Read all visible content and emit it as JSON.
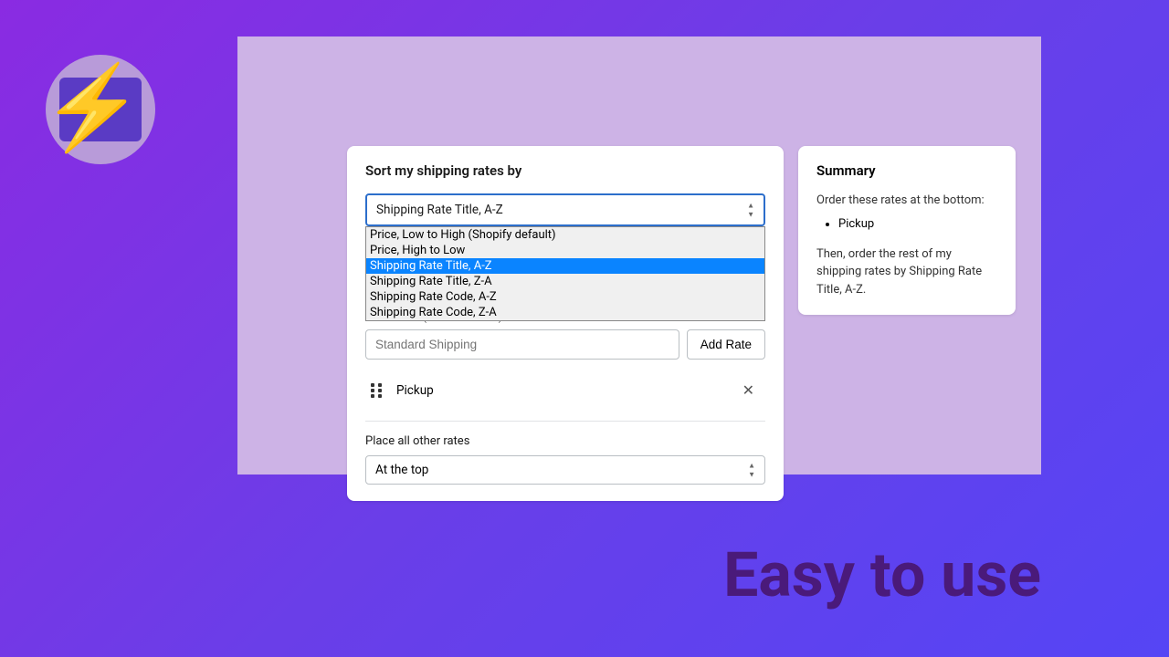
{
  "main": {
    "sort_title": "Sort my shipping rates by",
    "sort_selected": "Shipping Rate Title, A-Z",
    "dropdown_options": [
      "Price, Low to High (Shopify default)",
      "Price, High to Low",
      "Shipping Rate Title, A-Z",
      "Shipping Rate Title, Z-A",
      "Shipping Rate Code, A-Z",
      "Shipping Rate Code, Z-A"
    ],
    "rate_label": "Rate name (case sensitive)",
    "rate_placeholder": "Standard Shipping",
    "add_rate_label": "Add Rate",
    "pinned_rate": "Pickup",
    "place_label": "Place all other rates",
    "place_selected": "At the top"
  },
  "summary": {
    "heading": "Summary",
    "line1": "Order these rates at the bottom:",
    "item1": "Pickup",
    "line2": "Then, order the rest of my shipping rates by Shipping Rate Title, A-Z."
  },
  "headline": "Easy to use"
}
